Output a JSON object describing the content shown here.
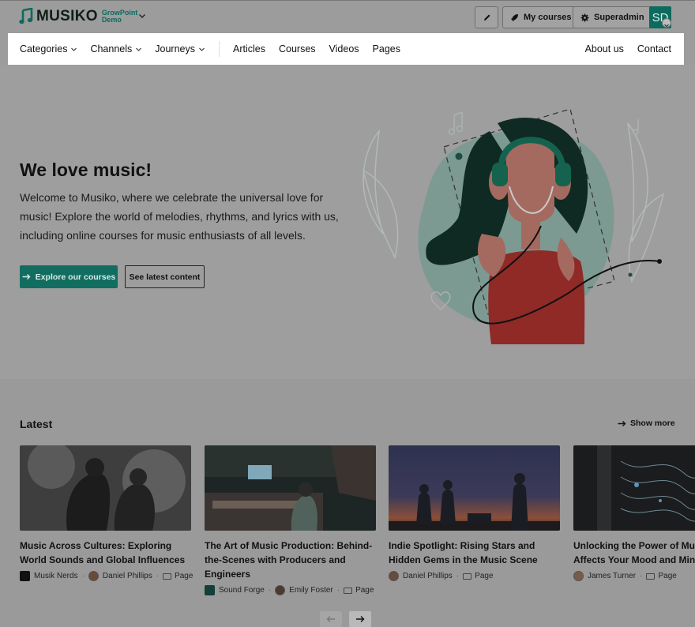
{
  "brand": {
    "name": "MUSIKO",
    "sub_line1": "GrowPoint",
    "sub_line2": "Demo"
  },
  "topbar": {
    "edit_label": "",
    "my_courses": "My courses",
    "superadmin": "Superadmin",
    "avatar_initials": "SD"
  },
  "nav": {
    "left": [
      "Categories",
      "Channels",
      "Journeys"
    ],
    "middle": [
      "Articles",
      "Courses",
      "Videos",
      "Pages"
    ],
    "right": [
      "About us",
      "Contact"
    ]
  },
  "hero": {
    "title": "We love music!",
    "text": "Welcome to Musiko, where we celebrate the universal love for music! Explore the world of melodies, rhythms, and lyrics with us, including online courses for music enthusiasts of all levels.",
    "primary_button": "Explore our courses",
    "secondary_button": "See latest content"
  },
  "latest": {
    "title": "Latest",
    "show_more": "Show more",
    "cards": [
      {
        "title": "Music Across Cultures: Exploring World Sounds and Global Influences",
        "channel": "Musik Nerds",
        "author": "Daniel Phillips",
        "type": "Page"
      },
      {
        "title": "The Art of Music Production: Behind-the-Scenes with Producers and Engineers",
        "channel": "Sound Forge",
        "author": "Emily Foster",
        "type": "Page"
      },
      {
        "title": "Indie Spotlight: Rising Stars and Hidden Gems in the Music Scene",
        "author": "Daniel Phillips",
        "type": "Page"
      },
      {
        "title": "Unlocking the Power of Music: How It Affects Your Mood and Mind",
        "author": "James Turner",
        "type": "Page"
      }
    ]
  },
  "colors": {
    "accent": "#126d61",
    "overlay": "#9c9c9c",
    "nav_bg": "#ffffff"
  }
}
